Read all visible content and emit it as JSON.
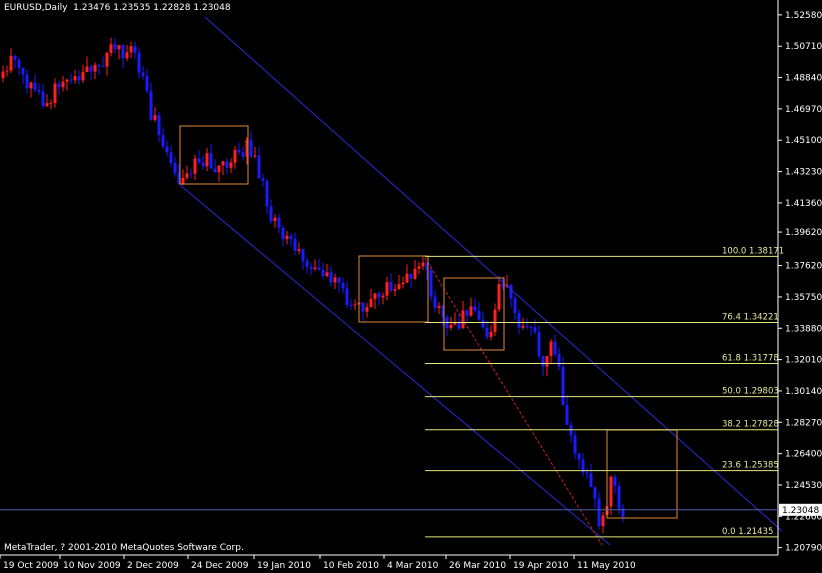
{
  "header": {
    "symbol": "EURUSD,Daily",
    "ohlc": "1.23476 1.23535 1.22828 1.23048"
  },
  "copyright": "MetaTrader, ? 2001-2010 MetaQuotes Software Corp.",
  "colors": {
    "background": "#000000",
    "bull": "#ff2020",
    "bear": "#1a1aff",
    "axis": "#ffffff",
    "channel": "#2a2ad8",
    "fib": "#e6e67a",
    "box": "#e08a3a",
    "trend": "#d02020",
    "bid_line": "#5060b0"
  },
  "chart_data": {
    "type": "candlestick",
    "ylim": [
      1.2059,
      1.5293
    ],
    "y_ticks": [
      "1.52580",
      "1.50710",
      "1.48840",
      "1.46970",
      "1.45100",
      "1.43230",
      "1.41360",
      "1.39620",
      "1.37620",
      "1.35750",
      "1.33880",
      "1.32010",
      "1.30140",
      "1.28270",
      "1.26400",
      "1.24530",
      "1.22660",
      "1.20790"
    ],
    "x_ticks": [
      "19 Oct 2009",
      "10 Nov 2009",
      "2 Dec 2009",
      "24 Dec 2009",
      "19 Jan 2010",
      "10 Feb 2010",
      "4 Mar 2010",
      "26 Mar 2010",
      "19 Apr 2010",
      "11 May 2010"
    ],
    "current_price": "1.23048",
    "close_path": [
      [
        0,
        1.488
      ],
      [
        8,
        1.497
      ],
      [
        16,
        1.5
      ],
      [
        22,
        1.492
      ],
      [
        30,
        1.484
      ],
      [
        38,
        1.478
      ],
      [
        46,
        1.472
      ],
      [
        55,
        1.481
      ],
      [
        64,
        1.492
      ],
      [
        72,
        1.486
      ],
      [
        80,
        1.492
      ],
      [
        88,
        1.497
      ],
      [
        96,
        1.493
      ],
      [
        104,
        1.499
      ],
      [
        112,
        1.508
      ],
      [
        120,
        1.502
      ],
      [
        128,
        1.507
      ],
      [
        135,
        1.5
      ],
      [
        140,
        1.493
      ],
      [
        146,
        1.478
      ],
      [
        152,
        1.466
      ],
      [
        158,
        1.458
      ],
      [
        163,
        1.447
      ],
      [
        168,
        1.44
      ],
      [
        173,
        1.432
      ],
      [
        178,
        1.427
      ],
      [
        184,
        1.425
      ],
      [
        190,
        1.433
      ],
      [
        196,
        1.44
      ],
      [
        202,
        1.436
      ],
      [
        208,
        1.44
      ],
      [
        214,
        1.434
      ],
      [
        220,
        1.438
      ],
      [
        226,
        1.434
      ],
      [
        231,
        1.437
      ],
      [
        236,
        1.446
      ],
      [
        241,
        1.444
      ],
      [
        247,
        1.447
      ],
      [
        252,
        1.442
      ],
      [
        257,
        1.434
      ],
      [
        262,
        1.424
      ],
      [
        267,
        1.414
      ],
      [
        272,
        1.403
      ],
      [
        277,
        1.406
      ],
      [
        282,
        1.394
      ],
      [
        288,
        1.396
      ],
      [
        294,
        1.388
      ],
      [
        300,
        1.381
      ],
      [
        306,
        1.378
      ],
      [
        312,
        1.372
      ],
      [
        318,
        1.369
      ],
      [
        324,
        1.372
      ],
      [
        330,
        1.368
      ],
      [
        336,
        1.364
      ],
      [
        342,
        1.36
      ],
      [
        348,
        1.355
      ],
      [
        353,
        1.352
      ],
      [
        358,
        1.356
      ],
      [
        364,
        1.352
      ],
      [
        370,
        1.358
      ],
      [
        376,
        1.355
      ],
      [
        382,
        1.36
      ],
      [
        388,
        1.362
      ],
      [
        394,
        1.366
      ],
      [
        400,
        1.362
      ],
      [
        406,
        1.368
      ],
      [
        412,
        1.372
      ],
      [
        418,
        1.374
      ],
      [
        424,
        1.376
      ],
      [
        428,
        1.368
      ],
      [
        433,
        1.358
      ],
      [
        438,
        1.352
      ],
      [
        443,
        1.342
      ],
      [
        448,
        1.335
      ],
      [
        453,
        1.344
      ],
      [
        458,
        1.341
      ],
      [
        463,
        1.348
      ],
      [
        468,
        1.352
      ],
      [
        474,
        1.346
      ],
      [
        479,
        1.344
      ],
      [
        484,
        1.338
      ],
      [
        489,
        1.334
      ],
      [
        493,
        1.345
      ],
      [
        498,
        1.359
      ],
      [
        503,
        1.366
      ],
      [
        508,
        1.36
      ],
      [
        513,
        1.352
      ],
      [
        518,
        1.344
      ],
      [
        523,
        1.34
      ],
      [
        528,
        1.337
      ],
      [
        533,
        1.334
      ],
      [
        538,
        1.328
      ],
      [
        543,
        1.321
      ],
      [
        548,
        1.324
      ],
      [
        553,
        1.327
      ],
      [
        557,
        1.318
      ],
      [
        561,
        1.306
      ],
      [
        565,
        1.288
      ],
      [
        569,
        1.275
      ],
      [
        573,
        1.266
      ],
      [
        577,
        1.262
      ],
      [
        581,
        1.255
      ],
      [
        585,
        1.258
      ],
      [
        589,
        1.25
      ],
      [
        593,
        1.238
      ],
      [
        597,
        1.228
      ],
      [
        601,
        1.218
      ],
      [
        605,
        1.228
      ],
      [
        609,
        1.242
      ],
      [
        613,
        1.25
      ],
      [
        617,
        1.24
      ],
      [
        621,
        1.232
      ],
      [
        624,
        1.23
      ]
    ],
    "fibonacci": [
      {
        "level": "100.0",
        "price": "1.38171",
        "value": 1.38171
      },
      {
        "level": "76.4",
        "price": "1.34221",
        "value": 1.34221
      },
      {
        "level": "61.8",
        "price": "1.31778",
        "value": 1.31778
      },
      {
        "level": "50.0",
        "price": "1.29803",
        "value": 1.29803
      },
      {
        "level": "38.2",
        "price": "1.27828",
        "value": 1.27828
      },
      {
        "level": "23.6",
        "price": "1.25385",
        "value": 1.25385
      },
      {
        "level": "0.0",
        "price": "1.21435",
        "value": 1.21435
      }
    ]
  }
}
